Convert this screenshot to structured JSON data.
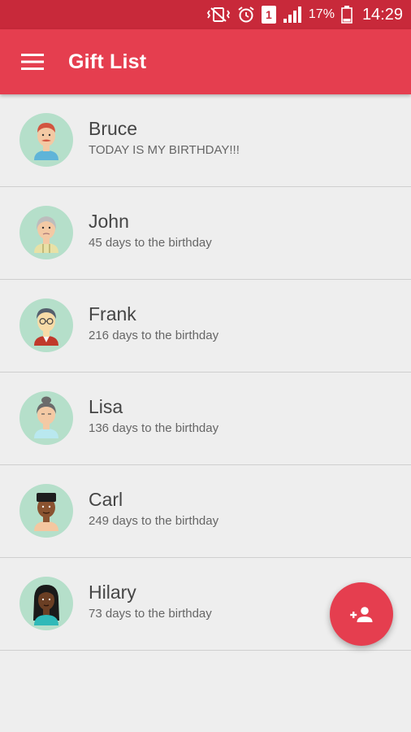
{
  "status_bar": {
    "sim_slot": "1",
    "battery_percent": "17%",
    "time": "14:29",
    "icons": [
      "vibrate-icon",
      "alarm-icon",
      "sim-icon",
      "signal-icon",
      "battery-icon"
    ]
  },
  "app_bar": {
    "title": "Gift List",
    "menu_icon": "hamburger-menu-icon"
  },
  "contacts": [
    {
      "name": "Bruce",
      "subtitle": "TODAY IS MY BIRTHDAY!!!",
      "avatar": "man-red-hair-mustache-avatar",
      "skin": "#f3c9a4",
      "hair": "#d2553f",
      "shirt": "#5fb4d8"
    },
    {
      "name": "John",
      "subtitle": "45 days to the birthday",
      "avatar": "old-man-gray-hair-avatar",
      "skin": "#f3c9a4",
      "hair": "#bdbdbd",
      "shirt": "#e8e1a6"
    },
    {
      "name": "Frank",
      "subtitle": "216 days to the birthday",
      "avatar": "man-glasses-avatar",
      "skin": "#f7dba7",
      "hair": "#55606d",
      "shirt": "#c0392b"
    },
    {
      "name": "Lisa",
      "subtitle": "136 days to the birthday",
      "avatar": "woman-bun-hair-avatar",
      "skin": "#f3c9a4",
      "hair": "#6b6b6b",
      "shirt": "#b9e8ef"
    },
    {
      "name": "Carl",
      "subtitle": "249 days to the birthday",
      "avatar": "man-dark-skin-avatar",
      "skin": "#8a5330",
      "hair": "#1e1e1e",
      "shirt": "#f4c7a0"
    },
    {
      "name": "Hilary",
      "subtitle": "73 days to the birthday",
      "avatar": "woman-dark-skin-long-hair-avatar",
      "skin": "#6b3f24",
      "hair": "#1a1a1a",
      "shirt": "#2fb9b8"
    }
  ],
  "fab": {
    "icon": "add-person-icon"
  },
  "colors": {
    "status_bar": "#c8293a",
    "app_bar": "#e53e4f",
    "accent": "#e53e4f",
    "avatar_bg": "#b5dfca",
    "background": "#eeeeee"
  }
}
